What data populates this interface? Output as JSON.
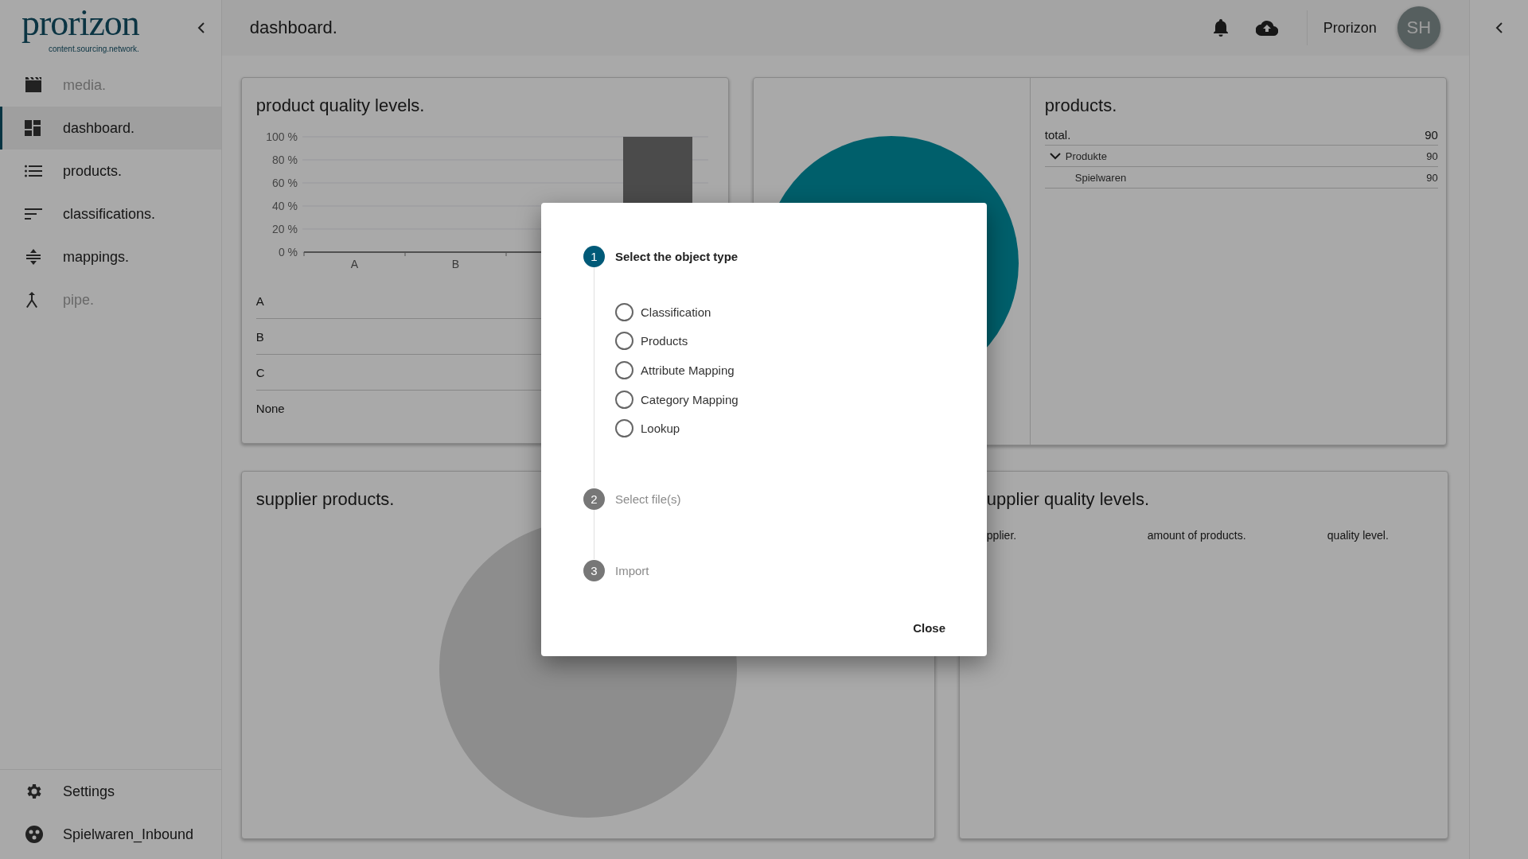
{
  "sidebar": {
    "logo": {
      "name": "prorizon",
      "tagline": "content.sourcing.network."
    },
    "items": [
      {
        "label": "media.",
        "selected": false,
        "disabled": true
      },
      {
        "label": "dashboard.",
        "selected": true,
        "disabled": false
      },
      {
        "label": "products.",
        "selected": false,
        "disabled": false
      },
      {
        "label": "classifications.",
        "selected": false,
        "disabled": false
      },
      {
        "label": "mappings.",
        "selected": false,
        "disabled": false
      },
      {
        "label": "pipe.",
        "selected": false,
        "disabled": true
      }
    ],
    "footer": [
      {
        "label": "Settings"
      },
      {
        "label": "Spielwaren_Inbound"
      }
    ]
  },
  "header": {
    "title": "dashboard.",
    "user": "Prorizon",
    "avatar": "SH"
  },
  "quality_card": {
    "title": "product quality levels.",
    "chart_data": {
      "type": "bar",
      "grid": true,
      "categories": [
        "A",
        "B",
        null,
        null
      ],
      "values": [
        0,
        0,
        null,
        100
      ],
      "ylim": [
        0,
        100
      ],
      "yticks": [
        {
          "value": 0,
          "label": "0 %"
        },
        {
          "value": 20,
          "label": "20 %"
        },
        {
          "value": 40,
          "label": "40 %"
        },
        {
          "value": 60,
          "label": "60 %"
        },
        {
          "value": 80,
          "label": "80 %"
        },
        {
          "value": 100,
          "label": "100 %"
        }
      ]
    },
    "rows": [
      "A",
      "B",
      "C",
      "None"
    ]
  },
  "products_card": {
    "title": "products.",
    "total": {
      "label": "total.",
      "value": "90"
    },
    "tree": [
      {
        "label": "Produkte",
        "value": "90",
        "expanded": true,
        "children": [
          {
            "label": "Spielwaren",
            "value": "90"
          }
        ]
      }
    ]
  },
  "supplier_products_card": {
    "title": "supplier products."
  },
  "supplier_quality_card": {
    "title": "upplier quality levels.",
    "columns": [
      "pplier.",
      "amount of products.",
      "quality level."
    ]
  },
  "dialog": {
    "steps": [
      {
        "number": "1",
        "label": "Select the object type",
        "active": true,
        "options": [
          {
            "label": "Classification",
            "selected": false
          },
          {
            "label": "Products",
            "selected": false
          },
          {
            "label": "Attribute Mapping",
            "selected": false
          },
          {
            "label": "Category Mapping",
            "selected": false
          },
          {
            "label": "Lookup",
            "selected": false
          }
        ]
      },
      {
        "number": "2",
        "label": "Select file(s)",
        "active": false
      },
      {
        "number": "3",
        "label": "Import",
        "active": false
      }
    ],
    "close": "Close"
  }
}
